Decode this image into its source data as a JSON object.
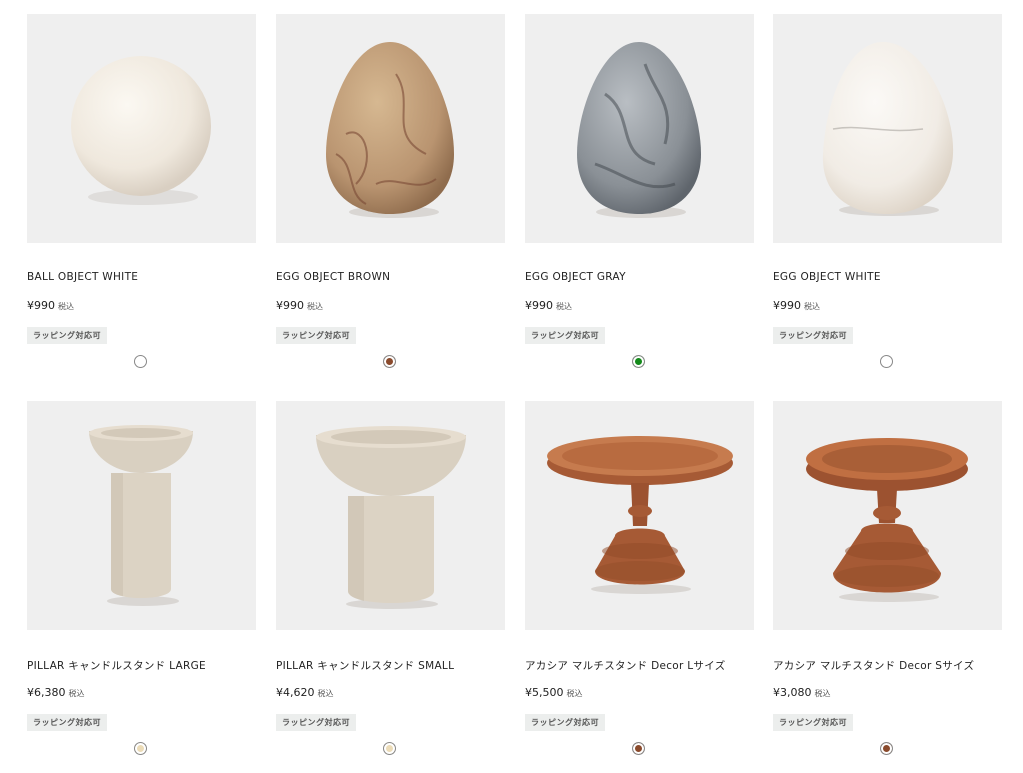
{
  "products": [
    {
      "name": "BALL OBJECT WHITE",
      "price": "¥990",
      "tax": "税込",
      "badge": "ラッピング対応可",
      "swatch_color": "#ffffff",
      "image_icon": "ball-white-image"
    },
    {
      "name": "EGG OBJECT BROWN",
      "price": "¥990",
      "tax": "税込",
      "badge": "ラッピング対応可",
      "swatch_color": "#8a4a2c",
      "image_icon": "egg-brown-image"
    },
    {
      "name": "EGG OBJECT GRAY",
      "price": "¥990",
      "tax": "税込",
      "badge": "ラッピング対応可",
      "swatch_color": "#138a1a",
      "image_icon": "egg-gray-image"
    },
    {
      "name": "EGG OBJECT WHITE",
      "price": "¥990",
      "tax": "税込",
      "badge": "ラッピング対応可",
      "swatch_color": "#ffffff",
      "image_icon": "egg-white-image"
    },
    {
      "name": "PILLAR キャンドルスタンド LARGE",
      "price": "¥6,380",
      "tax": "税込",
      "badge": "ラッピング対応可",
      "swatch_color": "#ecdcb8",
      "image_icon": "pillar-large-image"
    },
    {
      "name": "PILLAR キャンドルスタンド SMALL",
      "price": "¥4,620",
      "tax": "税込",
      "badge": "ラッピング対応可",
      "swatch_color": "#ecdcb8",
      "image_icon": "pillar-small-image"
    },
    {
      "name": "アカシア マルチスタンド Decor Lサイズ",
      "price": "¥5,500",
      "tax": "税込",
      "badge": "ラッピング対応可",
      "swatch_color": "#8a4a2c",
      "image_icon": "acacia-stand-large-image"
    },
    {
      "name": "アカシア マルチスタンド Decor Sサイズ",
      "price": "¥3,080",
      "tax": "税込",
      "badge": "ラッピング対応可",
      "swatch_color": "#8a4a2c",
      "image_icon": "acacia-stand-small-image"
    }
  ],
  "colors": {
    "image_bg": "#efefef",
    "badge_bg": "#eceeed",
    "text": "#222222"
  }
}
